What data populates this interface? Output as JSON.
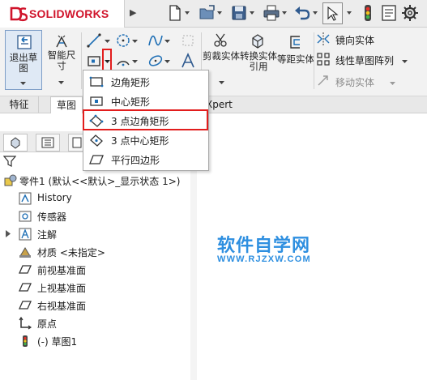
{
  "app": {
    "brand": "SOLIDWORKS",
    "logo_letters": "DS"
  },
  "ribbon": {
    "exit_sketch": "退出草图",
    "smart_dimension": "智能尺寸",
    "trim_entities": "剪裁实体",
    "convert_entities": "转换实体引用",
    "offset_entities": "等距实体",
    "mirror_entities": "镜向实体",
    "linear_pattern": "线性草图阵列",
    "move_entities": "移动实体"
  },
  "tabs": {
    "features": "特征",
    "sketch": "草图",
    "xpert": "Xpert"
  },
  "rectangle_menu": {
    "items": [
      {
        "label": "边角矩形",
        "icon": "corner-rectangle-icon"
      },
      {
        "label": "中心矩形",
        "icon": "center-rectangle-icon"
      },
      {
        "label": "3 点边角矩形",
        "icon": "3-point-corner-rectangle-icon"
      },
      {
        "label": "3 点中心矩形",
        "icon": "3-point-center-rectangle-icon"
      },
      {
        "label": "平行四边形",
        "icon": "parallelogram-icon"
      }
    ],
    "highlighted_index": 2
  },
  "feature_tree": {
    "root": "零件1 (默认<<默认>_显示状态 1>)",
    "items": [
      {
        "label": "History",
        "icon": "history-icon"
      },
      {
        "label": "传感器",
        "icon": "sensor-icon"
      },
      {
        "label": "注解",
        "icon": "annotations-icon"
      },
      {
        "label": "材质 <未指定>",
        "icon": "material-icon"
      },
      {
        "label": "前视基准面",
        "icon": "plane-icon"
      },
      {
        "label": "上视基准面",
        "icon": "plane-icon"
      },
      {
        "label": "右视基准面",
        "icon": "plane-icon"
      },
      {
        "label": "原点",
        "icon": "origin-icon"
      },
      {
        "label": "(-) 草图1",
        "icon": "sketch-icon"
      }
    ]
  },
  "watermark": {
    "title": "软件自学网",
    "url": "WWW.RJZXW.COM"
  },
  "colors": {
    "brand_red": "#d0142b",
    "highlight_red": "#e21d1d",
    "watermark_blue": "#2e8fe0",
    "icon_blue": "#1f6fb5"
  }
}
